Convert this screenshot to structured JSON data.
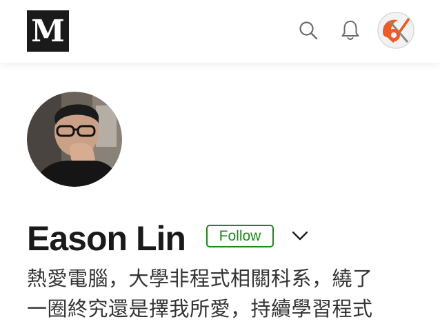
{
  "header": {
    "logo_text": "M",
    "icons": [
      "search-icon",
      "bell-icon"
    ],
    "avatar": "user-avatar"
  },
  "profile": {
    "name": "Eason Lin",
    "follow_label": "Follow",
    "bio_lines": [
      "熱愛電腦，大學非程式相關科系，繞了",
      "一圈終究還是擇我所愛，持續學習程式"
    ]
  },
  "colors": {
    "accent_green": "#1a8917",
    "logo_bg": "#1a1a1a",
    "avatar_orange": "#f15a24"
  }
}
